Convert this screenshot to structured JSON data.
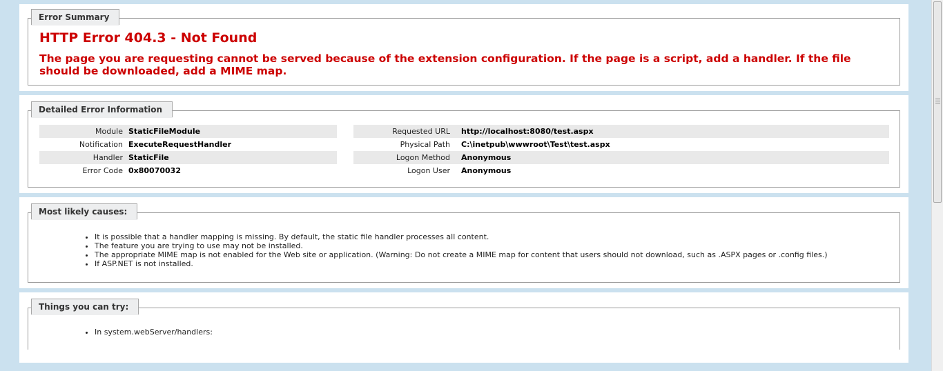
{
  "error_summary": {
    "legend": "Error Summary",
    "title": "HTTP Error 404.3 - Not Found",
    "message": "The page you are requesting cannot be served because of the extension configuration. If the page is a script, add a handler. If the file should be downloaded, add a MIME map."
  },
  "details": {
    "legend": "Detailed Error Information",
    "left": [
      {
        "key": "Module",
        "value": "StaticFileModule"
      },
      {
        "key": "Notification",
        "value": "ExecuteRequestHandler"
      },
      {
        "key": "Handler",
        "value": "StaticFile"
      },
      {
        "key": "Error Code",
        "value": "0x80070032"
      }
    ],
    "right": [
      {
        "key": "Requested URL",
        "value": "http://localhost:8080/test.aspx"
      },
      {
        "key": "Physical Path",
        "value": "C:\\inetpub\\wwwroot\\Test\\test.aspx"
      },
      {
        "key": "Logon Method",
        "value": "Anonymous"
      },
      {
        "key": "Logon User",
        "value": "Anonymous"
      }
    ]
  },
  "causes": {
    "legend": "Most likely causes:",
    "items": [
      "It is possible that a handler mapping is missing. By default, the static file handler processes all content.",
      "The feature you are trying to use may not be installed.",
      "The appropriate MIME map is not enabled for the Web site or application. (Warning: Do not create a MIME map for content that users should not download, such as .ASPX pages or .config files.)",
      "If ASP.NET is not installed."
    ]
  },
  "things": {
    "legend": "Things you can try:",
    "items": [
      "In system.webServer/handlers:"
    ]
  },
  "colors": {
    "background": "#cbe1ef",
    "error_red": "#cc0000",
    "row_shade": "#e9e9e9"
  }
}
